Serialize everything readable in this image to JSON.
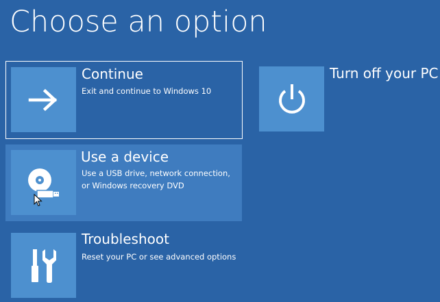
{
  "page_title": "Choose an option",
  "options": {
    "continue": {
      "title": "Continue",
      "description": "Exit and continue to Windows 10",
      "icon": "arrow-right-icon",
      "focused": true
    },
    "use_device": {
      "title": "Use a device",
      "description": "Use a USB drive, network connection, or Windows recovery DVD",
      "icon": "disc-usb-icon",
      "hovered": true
    },
    "troubleshoot": {
      "title": "Troubleshoot",
      "description": "Reset your PC or see advanced options",
      "icon": "tools-icon"
    },
    "turn_off": {
      "title": "Turn off your PC",
      "icon": "power-icon"
    }
  },
  "colors": {
    "background": "#2a63a6",
    "tile": "#4d90cf",
    "hover": "#3f7cbf",
    "text": "#ffffff"
  }
}
